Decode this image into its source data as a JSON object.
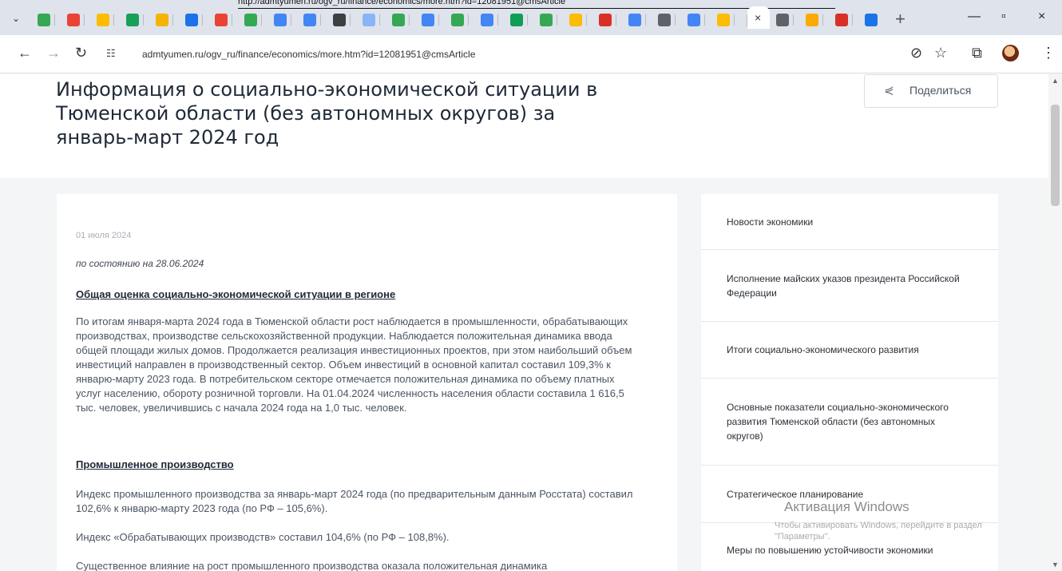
{
  "browser": {
    "top_link_text": "http://admtyumen.ru/ogv_ru/finance/economics/more.htm?id=12081951@cmsArticle",
    "url": "admtyumen.ru/ogv_ru/finance/economics/more.htm?id=12081951@cmsArticle",
    "tab_icons": [
      {
        "name": "google-drive-icon",
        "color": "#34a853"
      },
      {
        "name": "gmail-icon",
        "color": "#ea4335"
      },
      {
        "name": "bookmark-icon",
        "color": "#fbbc04"
      },
      {
        "name": "green-square-icon",
        "color": "#18a058"
      },
      {
        "name": "grid-icon",
        "color": "#f4b400"
      },
      {
        "name": "blue-circle-icon",
        "color": "#1a73e8"
      },
      {
        "name": "red-pin-icon",
        "color": "#ea4335"
      },
      {
        "name": "green-dot-icon",
        "color": "#34a853"
      },
      {
        "name": "blue-square-icon",
        "color": "#4285f4"
      },
      {
        "name": "document-icon",
        "color": "#4285f4"
      },
      {
        "name": "circle-icon",
        "color": "#3c4043"
      },
      {
        "name": "light-square-icon",
        "color": "#8ab4f8"
      },
      {
        "name": "check-icon",
        "color": "#34a853"
      },
      {
        "name": "map-icon",
        "color": "#4285f4"
      },
      {
        "name": "tree-icon",
        "color": "#34a853"
      },
      {
        "name": "tile-icon",
        "color": "#4285f4"
      },
      {
        "name": "teal-square-icon",
        "color": "#0f9d58"
      },
      {
        "name": "leaf-icon",
        "color": "#34a853"
      },
      {
        "name": "star-icon",
        "color": "#fbbc04"
      },
      {
        "name": "pink-dot-icon",
        "color": "#d93025"
      },
      {
        "name": "mail-icon",
        "color": "#4285f4"
      },
      {
        "name": "chrome-icon",
        "color": "#5f6368"
      },
      {
        "name": "google-icon",
        "color": "#4285f4"
      },
      {
        "name": "brand-icon",
        "color": "#fbbc04"
      },
      {
        "name": "active-tab-icon",
        "color": "#ffffff"
      },
      {
        "name": "triangle-icon",
        "color": "#5f6368"
      },
      {
        "name": "flower-icon",
        "color": "#f9ab00"
      },
      {
        "name": "red-badge-icon",
        "color": "#d93025"
      },
      {
        "name": "sheet-icon",
        "color": "#1a73e8"
      }
    ]
  },
  "page": {
    "title": "Информация о социально-экономической ситуации в Тюменской области (без автономных округов) за январь-март 2024 год",
    "share_label": "Поделиться",
    "date": "01 июля 2024",
    "status": "по состоянию на 28.06.2024",
    "section1_title": "Общая оценка социально-экономической ситуации в регионе",
    "section1_text": "По итогам января-марта 2024 года в Тюменской области рост наблюдается в промышленности, обрабатывающих производствах, производстве сельскохозяйственной продукции. Наблюдается положительная динамика ввода общей площади жилых домов. Продолжается реализация инвестиционных проектов, при этом наибольший объем инвестиций направлен в производственный сектор. Объем инвестиций в основной капитал составил 109,3% к январю-марту 2023 года. В потребительском секторе отмечается положительная динамика по объему платных услуг населению, обороту розничной торговли. На 01.04.2024 численность населения области составила 1 616,5 тыс. человек, увеличившись с начала 2024 года на 1,0 тыс. человек.",
    "section2_title": "Промышленное производство",
    "section2_text1": "Индекс промышленного производства за январь-март 2024 года (по предварительным данным Росстата) составил 102,6% к январю-марту 2023 года (по РФ – 105,6%).",
    "section2_text2": "Индекс «Обрабатывающих производств» составил 104,6% (по РФ – 108,8%).",
    "section2_text3": "Существенное влияние на рост промышленного производства оказала положительная динамика"
  },
  "sidebar": {
    "items": [
      "Новости экономики",
      "Исполнение майских указов президента Российской Федерации",
      "Итоги социально-экономического развития",
      "Основные показатели социально-экономического развития Тюменской области (без автономных округов)",
      "Стратегическое планирование",
      "Меры по повышению устойчивости экономики"
    ]
  },
  "windows_watermark": {
    "title": "Активация Windows",
    "subtitle": "Чтобы активировать Windows, перейдите в раздел \"Параметры\"."
  }
}
